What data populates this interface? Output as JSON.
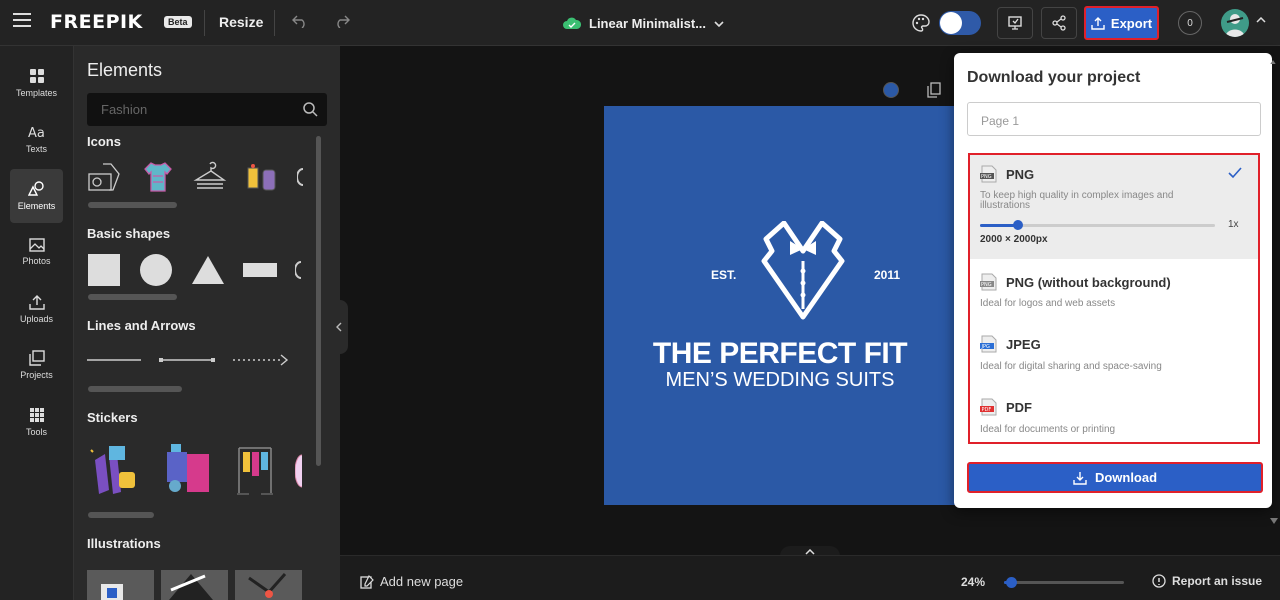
{
  "app": {
    "logo": "FREEPIK",
    "badge": "Beta",
    "resize_label": "Resize",
    "document_title": "Linear Minimalist...",
    "export_label": "Export",
    "credits": "0"
  },
  "rail": {
    "items": [
      {
        "label": "Templates",
        "icon": "templates-icon"
      },
      {
        "label": "Texts",
        "icon": "text-icon"
      },
      {
        "label": "Elements",
        "icon": "elements-icon",
        "active": true
      },
      {
        "label": "Photos",
        "icon": "photos-icon"
      },
      {
        "label": "Uploads",
        "icon": "upload-icon"
      },
      {
        "label": "Projects",
        "icon": "projects-icon"
      },
      {
        "label": "Tools",
        "icon": "tools-icon"
      }
    ]
  },
  "panel": {
    "title": "Elements",
    "search": {
      "placeholder": "Fashion",
      "value": ""
    },
    "sections": [
      {
        "title": "Icons"
      },
      {
        "title": "Basic shapes"
      },
      {
        "title": "Lines and Arrows"
      },
      {
        "title": "Stickers"
      },
      {
        "title": "Illustrations"
      }
    ]
  },
  "design": {
    "est": "EST.",
    "year": "2011",
    "headline": "THE PERFECT FIT",
    "subheadline": "MEN’S WEDDING SUITS",
    "background": "#2b59a6"
  },
  "bottom": {
    "add_page": "Add new page",
    "zoom": "24%",
    "zoom_fraction": 0.06,
    "report": "Report an issue"
  },
  "download": {
    "title": "Download your project",
    "page_select": "Page 1",
    "formats": [
      {
        "name": "PNG",
        "badge": "PNG",
        "badge_color": "#555",
        "desc": "To keep high quality in complex images and illustrations",
        "selected": true
      },
      {
        "name": "PNG (without background)",
        "badge": "PNG",
        "badge_color": "#888",
        "desc": "Ideal for logos and web assets"
      },
      {
        "name": "JPEG",
        "badge": "JPG",
        "badge_color": "#2b6fd6",
        "desc": "Ideal for digital sharing and space-saving"
      },
      {
        "name": "PDF",
        "badge": "PDF",
        "badge_color": "#e03030",
        "desc": "Ideal for documents or printing"
      }
    ],
    "size_multiplier": "1x",
    "size_fraction": 0.16,
    "dimensions": "2000 × 2000px",
    "button": "Download"
  },
  "colors": {
    "accent": "#2b5fc6",
    "highlight": "#e0202a"
  }
}
